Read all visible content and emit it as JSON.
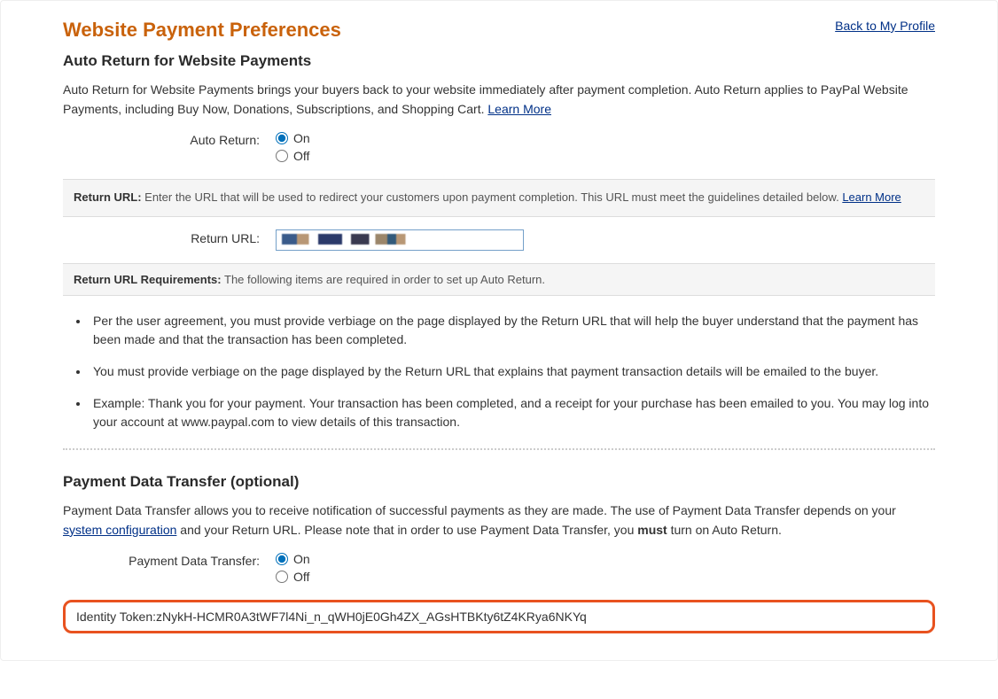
{
  "header": {
    "page_title": "Website Payment Preferences",
    "back_link": "Back to My Profile"
  },
  "auto_return": {
    "section_title": "Auto Return for Website Payments",
    "body_text": "Auto Return for Website Payments brings your buyers back to your website immediately after payment completion. Auto Return applies to PayPal Website Payments, including Buy Now, Donations, Subscriptions, and Shopping Cart. ",
    "learn_more": "Learn More",
    "label": "Auto Return:",
    "option_on": "On",
    "option_off": "Off",
    "return_url_info_label": "Return URL:",
    "return_url_info_text": " Enter the URL that will be used to redirect your customers upon payment completion. This URL must meet the guidelines detailed below. ",
    "return_url_info_link": "Learn More",
    "return_url_field_label": "Return URL:",
    "requirements_label": "Return URL Requirements:",
    "requirements_text": " The following items are required in order to set up Auto Return.",
    "req_items": [
      "Per the user agreement, you must provide verbiage on the page displayed by the Return URL that will help the buyer understand that the payment has been made and that the transaction has been completed.",
      "You must provide verbiage on the page displayed by the Return URL that explains that payment transaction details will be emailed to the buyer.",
      "Example: Thank you for your payment. Your transaction has been completed, and a receipt for your purchase has been emailed to you. You may log into your account at www.paypal.com to view details of this transaction."
    ]
  },
  "pdt": {
    "section_title": "Payment Data Transfer (optional)",
    "body_pre": "Payment Data Transfer allows you to receive notification of successful payments as they are made. The use of Payment Data Transfer depends on your ",
    "sysconfig_link": "system configuration",
    "body_mid": " and your Return URL. Please note that in order to use Payment Data Transfer, you ",
    "must_word": "must",
    "body_post": " turn on Auto Return.",
    "label": "Payment Data Transfer:",
    "option_on": "On",
    "option_off": "Off",
    "identity_token_label": "Identity Token:",
    "identity_token_value": "zNykH-HCMR0A3tWF7l4Ni_n_qWH0jE0Gh4ZX_AGsHTBKty6tZ4KRya6NKYq"
  }
}
